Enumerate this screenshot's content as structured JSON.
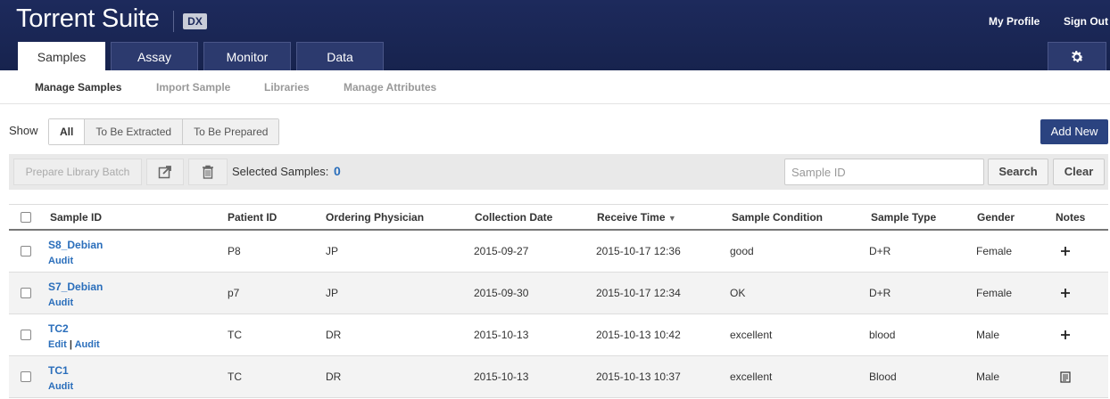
{
  "header": {
    "brand": "Torrent Suite",
    "badge": "DX",
    "my_profile": "My Profile",
    "sign_out": "Sign Out",
    "tabs": [
      {
        "label": "Samples"
      },
      {
        "label": "Assay"
      },
      {
        "label": "Monitor"
      },
      {
        "label": "Data"
      }
    ],
    "settings_icon": "gear-icon"
  },
  "subnav": {
    "items": [
      {
        "label": "Manage Samples"
      },
      {
        "label": "Import Sample"
      },
      {
        "label": "Libraries"
      },
      {
        "label": "Manage Attributes"
      }
    ]
  },
  "filters": {
    "show_label": "Show",
    "options": [
      "All",
      "To Be Extracted",
      "To Be Prepared"
    ],
    "add_new": "Add New"
  },
  "toolbar": {
    "prepare_batch": "Prepare Library Batch",
    "export_icon": "export-icon",
    "delete_icon": "trash-icon",
    "selected_label": "Selected Samples:",
    "selected_count": "0",
    "search_placeholder": "Sample ID",
    "search_value": "",
    "search_button": "Search",
    "clear_button": "Clear"
  },
  "table": {
    "columns": [
      "Sample ID",
      "Patient ID",
      "Ordering Physician",
      "Collection Date",
      "Receive Time",
      "Sample Condition",
      "Sample Type",
      "Gender",
      "Notes"
    ],
    "sort_indicator": "▼",
    "rows": [
      {
        "sample_id": "S8_Debian",
        "actions": [
          "Audit"
        ],
        "patient_id": "P8",
        "physician": "JP",
        "collection_date": "2015-09-27",
        "receive_time": "2015-10-17 12:36",
        "condition": "good",
        "type": "D+R",
        "gender": "Female",
        "notes_icon": "plus-icon"
      },
      {
        "sample_id": "S7_Debian",
        "actions": [
          "Audit"
        ],
        "patient_id": "p7",
        "physician": "JP",
        "collection_date": "2015-09-30",
        "receive_time": "2015-10-17 12:34",
        "condition": "OK",
        "type": "D+R",
        "gender": "Female",
        "notes_icon": "plus-icon"
      },
      {
        "sample_id": "TC2",
        "actions": [
          "Edit",
          "Audit"
        ],
        "patient_id": "TC",
        "physician": "DR",
        "collection_date": "2015-10-13",
        "receive_time": "2015-10-13 10:42",
        "condition": "excellent",
        "type": "blood",
        "gender": "Male",
        "notes_icon": "plus-icon"
      },
      {
        "sample_id": "TC1",
        "actions": [
          "Audit"
        ],
        "patient_id": "TC",
        "physician": "DR",
        "collection_date": "2015-10-13",
        "receive_time": "2015-10-13 10:37",
        "condition": "excellent",
        "type": "Blood",
        "gender": "Male",
        "notes_icon": "note-icon"
      }
    ]
  }
}
